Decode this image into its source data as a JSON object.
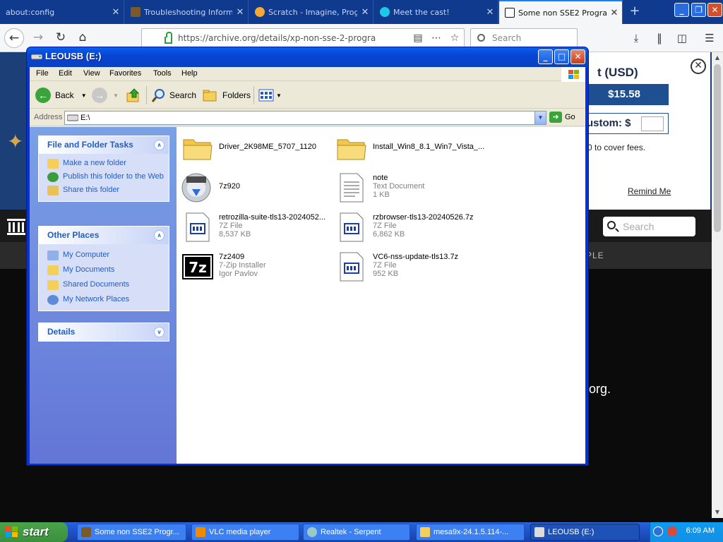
{
  "browser": {
    "tabs": [
      {
        "title": "about:config",
        "close": "✕"
      },
      {
        "title": "Troubleshooting Inform",
        "close": "✕"
      },
      {
        "title": "Scratch - Imagine, Prog",
        "close": "✕"
      },
      {
        "title": "Meet the cast!",
        "close": "✕"
      },
      {
        "title": "Some non SSE2 Progra",
        "close": "✕"
      }
    ],
    "new_tab": "+",
    "url": "https://archive.org/details/xp-non-sse-2-progra",
    "search_placeholder": "Search",
    "window_controls": [
      "_",
      "❐",
      "✕"
    ]
  },
  "webpage": {
    "donate_title": "t (USD)",
    "donate_amount": "$15.58",
    "donate_custom": "ustom: $",
    "donate_fees": "0 to cover fees.",
    "remind_me": "Remind Me",
    "close": "✕",
    "search_placeholder": "Search",
    "people": "PLE",
    "org_text": "org."
  },
  "explorer": {
    "title": "LEOUSB (E:)",
    "title_buttons": [
      "_",
      "□",
      "✕"
    ],
    "menu": [
      "File",
      "Edit",
      "View",
      "Favorites",
      "Tools",
      "Help"
    ],
    "toolbar": {
      "back": "Back",
      "search": "Search",
      "folders": "Folders"
    },
    "address_label": "Address",
    "address_value": "E:\\",
    "go_label": "Go",
    "panels": [
      {
        "title": "File and Folder Tasks",
        "links": [
          "Make a new folder",
          "Publish this folder to the Web",
          "Share this folder"
        ]
      },
      {
        "title": "Other Places",
        "links": [
          "My Computer",
          "My Documents",
          "Shared Documents",
          "My Network Places"
        ]
      },
      {
        "title": "Details",
        "links": []
      }
    ],
    "files": [
      {
        "name": "Driver_2K98ME_5707_1120",
        "lines": [],
        "icon": "folder-icon"
      },
      {
        "name": "Install_Win8_8.1_Win7_Vista_...",
        "lines": [],
        "icon": "folder-icon"
      },
      {
        "name": "7z920",
        "lines": [],
        "icon": "disc-installer-icon"
      },
      {
        "name": "note",
        "lines": [
          "Text Document",
          "1 KB"
        ],
        "icon": "text-document-icon"
      },
      {
        "name": "retrozilla-suite-tls13-2024052...",
        "lines": [
          "7Z File",
          "8,537 KB"
        ],
        "icon": "archive-file-icon"
      },
      {
        "name": "rzbrowser-tls13-20240526.7z",
        "lines": [
          "7Z File",
          "6,862 KB"
        ],
        "icon": "archive-file-icon"
      },
      {
        "name": "7z2409",
        "lines": [
          "7-Zip Installer",
          "Igor Pavlov"
        ],
        "icon": "7zip-logo-icon"
      },
      {
        "name": "VC6-nss-update-tls13.7z",
        "lines": [
          "7Z File",
          "952 KB"
        ],
        "icon": "archive-file-icon"
      }
    ]
  },
  "taskbar": {
    "start": "start",
    "buttons": [
      "Some non SSE2 Progr...",
      "VLC media player",
      "Realtek - Serpent",
      "mesa9x-24.1.5.114-...",
      "LEOUSB (E:)"
    ],
    "clock": "6:09 AM"
  },
  "colors": {
    "xp_blue": "#0831d9",
    "ff_tabbar": "#0f3a8e",
    "task_link": "#215dc6",
    "start_green": "#3c8f3e"
  }
}
